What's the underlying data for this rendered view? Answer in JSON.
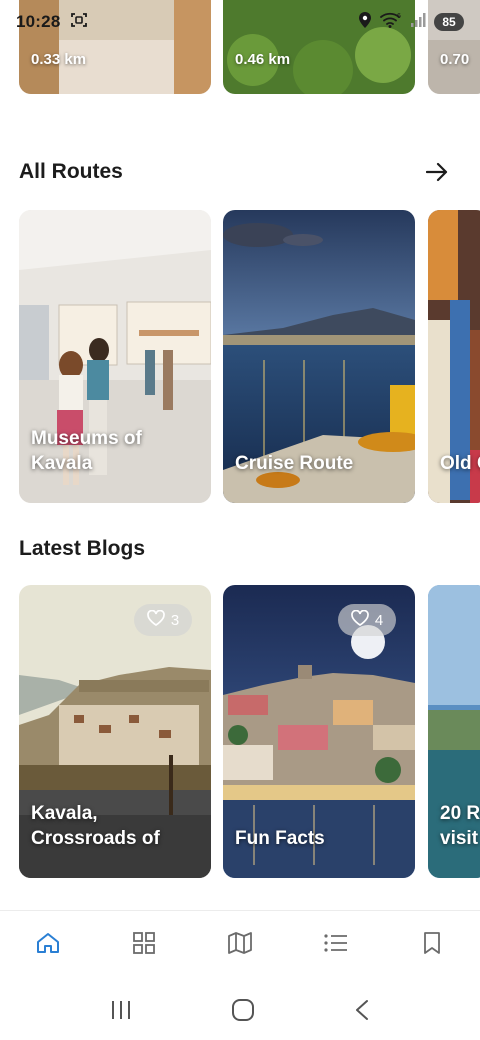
{
  "status_bar": {
    "time": "10:28",
    "battery": "85",
    "wifi_badge": "6"
  },
  "top_row": {
    "items": [
      {
        "distance": "0.33 km"
      },
      {
        "distance": "0.46 km"
      },
      {
        "distance": "0.70"
      }
    ]
  },
  "all_routes": {
    "title": "All Routes",
    "items": [
      {
        "label": "Museums of\nKavala"
      },
      {
        "label": "Cruise Route"
      },
      {
        "label": "Old C"
      }
    ]
  },
  "latest_blogs": {
    "title": "Latest Blogs",
    "items": [
      {
        "label": "Kavala,\nCrossroads of",
        "likes": "3"
      },
      {
        "label": "Fun Facts",
        "likes": "4"
      },
      {
        "label": "20 R\nvisit",
        "likes": ""
      }
    ]
  },
  "bottom_nav": {
    "items": [
      {
        "icon": "home-icon",
        "active": true
      },
      {
        "icon": "grid-icon",
        "active": false
      },
      {
        "icon": "map-icon",
        "active": false
      },
      {
        "icon": "list-icon",
        "active": false
      },
      {
        "icon": "bookmark-icon",
        "active": false
      }
    ]
  },
  "colors": {
    "accent": "#2a7fd4",
    "icon_gray": "#6b6b6b"
  }
}
